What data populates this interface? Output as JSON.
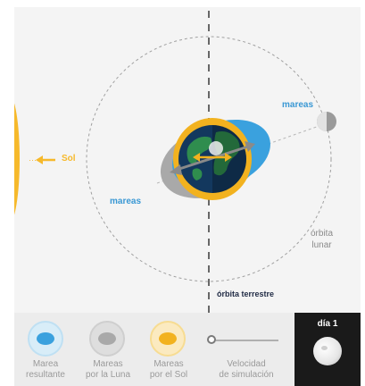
{
  "scene": {
    "sun_label": "Sol",
    "tides_label_upper": "mareas",
    "tides_label_lower": "mareas",
    "lunar_orbit_label": "órbita\nlunar",
    "earth_orbit_label": "órbita terrestre"
  },
  "controls": {
    "resultant_tide": "Marea\nresultante",
    "moon_tides": "Mareas\npor la Luna",
    "sun_tides": "Mareas\npor el Sol",
    "speed": "Velocidad\nde simulación",
    "day": "día 1"
  },
  "colors": {
    "sun": "#f6b92b",
    "tide_moon": "#3aa1de",
    "tide_sun": "#f2b21f",
    "tide_moon_gray": "#a9a9a9",
    "ocean": "#13385e",
    "land": "#2f8d4e",
    "label_blue": "#3a98d4",
    "orbit_label_dark": "#1f2a44"
  }
}
